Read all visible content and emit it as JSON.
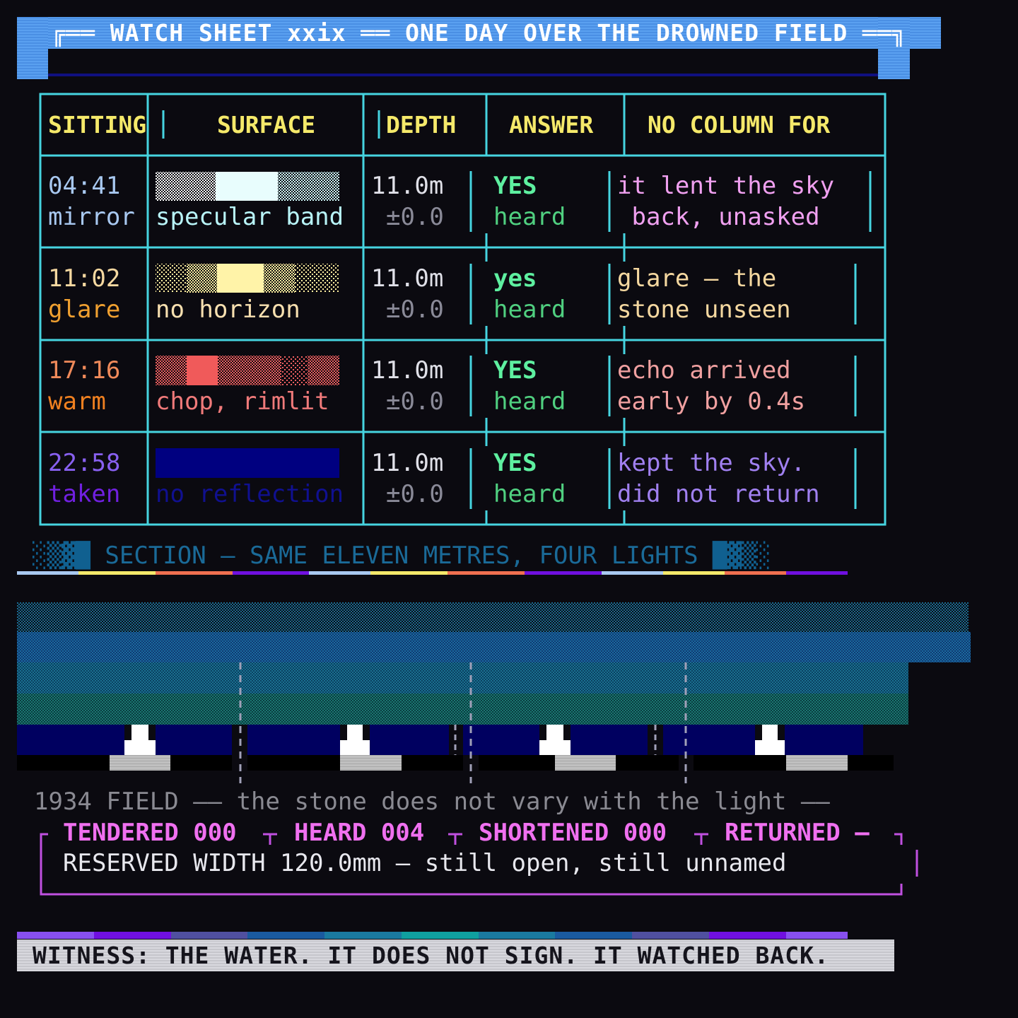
{
  "header": {
    "title": "╔══ WATCH SHEET xxix ══ ONE DAY OVER THE DROWNED FIELD ══╗"
  },
  "table": {
    "columns": [
      "SITTING",
      "SURFACE",
      "DEPTH",
      "ANSWER",
      "NO COLUMN FOR"
    ],
    "rows": [
      {
        "time": "04:41",
        "light": "mirror",
        "surface": "specular band",
        "depth": "11.0m",
        "tolerance": "±0.0",
        "answer": "YES",
        "answer_sub": "heard",
        "note1": "it lent the sky",
        "note2": " back, unasked",
        "time_color": "#a8c8f0",
        "surface_color": "#b8f4f8",
        "note_color": "#f0a0f0"
      },
      {
        "time": "11:02",
        "light": "glare",
        "surface": "no horizon",
        "depth": "11.0m",
        "tolerance": "±0.0",
        "answer": "yes",
        "answer_sub": "heard",
        "note1": "glare — the",
        "note2": "stone unseen",
        "time_color": "#f5d8a0",
        "surface_color": "#f8e0b0",
        "note_color": "#f5d8a0"
      },
      {
        "time": "17:16",
        "light": "warm",
        "surface": "chop, rimlit",
        "depth": "11.0m",
        "tolerance": "±0.0",
        "answer": "YES",
        "answer_sub": "heard",
        "note1": "echo arrived",
        "note2": "early by 0.4s",
        "time_color": "#f08a5a",
        "surface_color": "#f07a7a",
        "note_color": "#f0a0a0"
      },
      {
        "time": "22:58",
        "light": "taken",
        "surface": "no reflection",
        "depth": "11.0m",
        "tolerance": "±0.0",
        "answer": "YES",
        "answer_sub": "heard",
        "note1": "kept the sky.",
        "note2": "did not return",
        "time_color": "#8860f0",
        "surface_color": "#101090",
        "note_color": "#a080f0"
      }
    ]
  },
  "section": {
    "title": "SECTION — SAME ELEVEN METRES, FOUR LIGHTS",
    "left_blocks": "░▒▓█",
    "right_blocks": "█▓▒░"
  },
  "footer": {
    "note": "1934 FIELD —— the stone does not vary with the light ——",
    "tally": {
      "tendered": "TENDERED 000",
      "heard": "HEARD 004",
      "shortened": "SHORTENED 000",
      "returned": "RETURNED —"
    },
    "reserved": "RESERVED WIDTH 120.0mm — still open, still unnamed",
    "witness": "WITNESS: THE WATER. IT DOES NOT SIGN. IT WATCHED BACK."
  },
  "colors": {
    "grid": "#46d4e0",
    "header_blue": "#5aa0f0",
    "answer_green": "#5ef0a0",
    "heard_green": "#50d080",
    "tally_pink": "#f070f0",
    "frame_violet": "#c050e0"
  }
}
